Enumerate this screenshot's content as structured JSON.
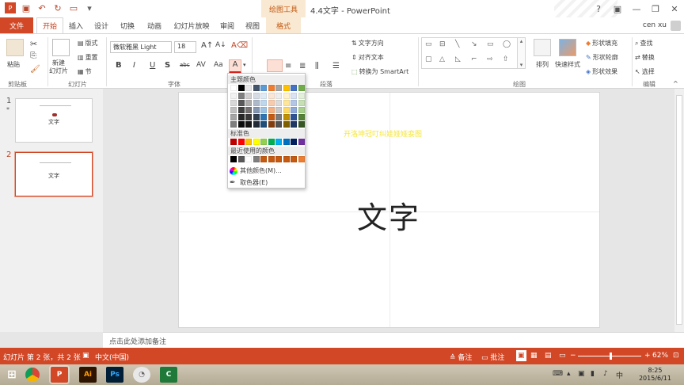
{
  "window": {
    "title": "4.4文字 - PowerPoint",
    "context_tab_title": "绘图工具",
    "user": "cen xu"
  },
  "tabs": [
    {
      "label": "文件"
    },
    {
      "label": "开始"
    },
    {
      "label": "插入"
    },
    {
      "label": "设计"
    },
    {
      "label": "切换"
    },
    {
      "label": "动画"
    },
    {
      "label": "幻灯片放映"
    },
    {
      "label": "审阅"
    },
    {
      "label": "视图"
    },
    {
      "label": "格式"
    }
  ],
  "ribbon": {
    "clipboard": {
      "paste": "粘贴",
      "group": "剪贴板"
    },
    "slides": {
      "new_slide": "新建\n幻灯片",
      "layout": "版式",
      "reset": "重置",
      "section": "节",
      "group": "幻灯片"
    },
    "font": {
      "font_name": "微软雅黑 Light",
      "font_size": "18",
      "bold": "B",
      "italic": "I",
      "underline": "U",
      "strike": "S",
      "shadow": "abc",
      "spacing": "AV",
      "case": "Aa",
      "font_color": "A",
      "group": "字体"
    },
    "paragraph": {
      "text_direction": "文字方向",
      "align_text": "对齐文本",
      "smartart": "转换为 SmartArt",
      "group": "段落"
    },
    "drawing": {
      "arrange": "排列",
      "quick_styles": "快速样式",
      "fill": "形状填充",
      "outline": "形状轮廓",
      "effects": "形状效果",
      "group": "绘图"
    },
    "editing": {
      "find": "查找",
      "replace": "替换",
      "select": "选择",
      "group": "编辑"
    }
  },
  "color_dropdown": {
    "theme_header": "主题颜色",
    "standard_header": "标准色",
    "recent_header": "最近使用的颜色",
    "more_colors": "其他颜色(M)...",
    "eyedropper": "取色器(E)",
    "theme_top": [
      "#ffffff",
      "#000000",
      "#e7e6e6",
      "#44546a",
      "#5b9bd5",
      "#ed7d31",
      "#a5a5a5",
      "#ffc000",
      "#4472c4",
      "#70ad47"
    ],
    "theme_shades": [
      [
        "#f2f2f2",
        "#7f7f7f",
        "#d0cece",
        "#d6dce4",
        "#deebf6",
        "#fbe5d5",
        "#ededed",
        "#fff2cc",
        "#dae3f3",
        "#e2efd9"
      ],
      [
        "#d8d8d8",
        "#595959",
        "#aeabab",
        "#adb9ca",
        "#bdd7ee",
        "#f7cbac",
        "#dbdbdb",
        "#fee599",
        "#b4c6e7",
        "#c5e0b3"
      ],
      [
        "#bfbfbf",
        "#3f3f3f",
        "#757070",
        "#8496b0",
        "#9cc3e5",
        "#f4b183",
        "#c9c9c9",
        "#ffd965",
        "#8eaadb",
        "#a8d08d"
      ],
      [
        "#a5a5a5",
        "#262626",
        "#3a3838",
        "#323f4f",
        "#2e75b5",
        "#c55a11",
        "#7b7b7b",
        "#bf9000",
        "#2f5496",
        "#538135"
      ],
      [
        "#7f7f7f",
        "#0c0c0c",
        "#171616",
        "#222a35",
        "#1e4e79",
        "#833c0b",
        "#525252",
        "#7f6000",
        "#1f3864",
        "#375623"
      ]
    ],
    "standard": [
      "#c00000",
      "#ff0000",
      "#ffc000",
      "#ffff00",
      "#92d050",
      "#00b050",
      "#00b0f0",
      "#0070c0",
      "#002060",
      "#7030a0"
    ],
    "recent": [
      "#000000",
      "#595959",
      "#ffffff",
      "#7f7f7f",
      "#c55a11",
      "#c55a11",
      "#c55a11",
      "#c55a11",
      "#c55a11",
      "#ed7d31"
    ]
  },
  "slides_pane": [
    {
      "number": "1",
      "star": "*",
      "text": "文字"
    },
    {
      "number": "2",
      "text": "文字"
    }
  ],
  "slide": {
    "main_text": "文字",
    "yellow_text": "开洛坤冠叮纠娃娅娅娈图"
  },
  "notes": {
    "placeholder": "点击此处添加备注"
  },
  "status": {
    "slide_info": "幻灯片 第 2 张，共 2 张",
    "language": "中文(中国)",
    "notes_btn": "备注",
    "comments_btn": "批注",
    "zoom": "62%",
    "zoom_level": 0.62
  },
  "taskbar": {
    "time": "8:25",
    "date": "2015/6/11",
    "apps": [
      "Ai",
      "Ps"
    ]
  },
  "colors": {
    "accent": "#d24726",
    "ctx_tab": "#f9e8d2"
  }
}
